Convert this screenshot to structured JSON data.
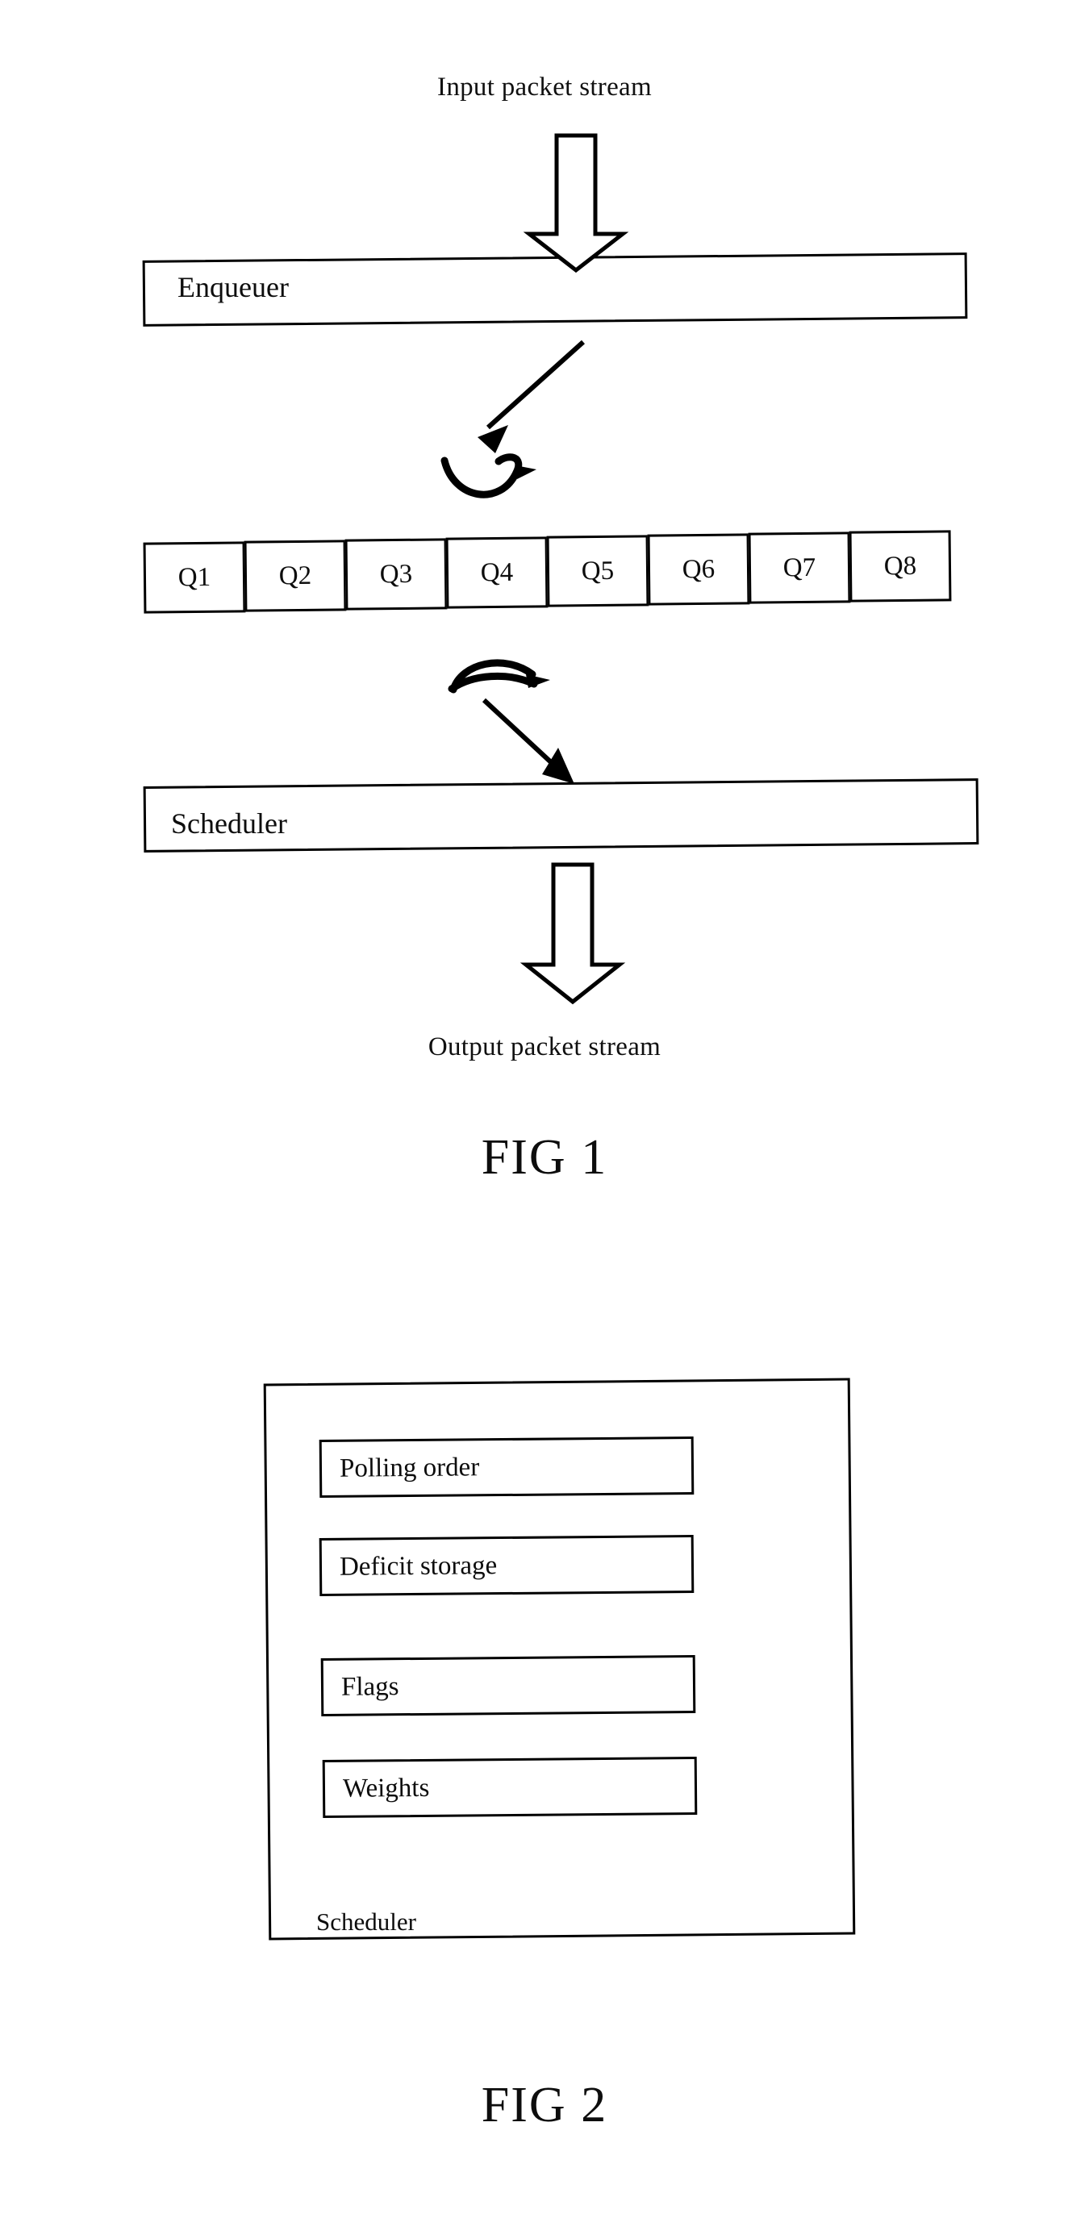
{
  "document": {
    "type": "patent-figures",
    "background_color": "#ffffff",
    "ink_color": "#000000"
  },
  "figure1": {
    "caption": "FIG 1",
    "input_label": "Input packet stream",
    "output_label": "Output packet stream",
    "enqueuer_label": "Enqueuer",
    "scheduler_label": "Scheduler",
    "queues": [
      {
        "label": "Q1"
      },
      {
        "label": "Q2"
      },
      {
        "label": "Q3"
      },
      {
        "label": "Q4"
      },
      {
        "label": "Q5"
      },
      {
        "label": "Q6"
      },
      {
        "label": "Q7"
      },
      {
        "label": "Q8"
      }
    ],
    "connectors": {
      "input_arrow": "hollow-down-arrow",
      "enqueue_arrow": "diagonal-arrow-down-left",
      "enqueue_squiggle": "curved-arc-symbol",
      "dequeue_squiggle": "curved-arc-symbol",
      "dequeue_arrow": "diagonal-arrow-down-right",
      "output_arrow": "hollow-down-arrow"
    }
  },
  "figure2": {
    "caption": "FIG 2",
    "container_label": "Scheduler",
    "items": [
      {
        "label": "Polling order"
      },
      {
        "label": "Deficit storage"
      },
      {
        "label": "Flags"
      },
      {
        "label": "Weights"
      }
    ]
  }
}
